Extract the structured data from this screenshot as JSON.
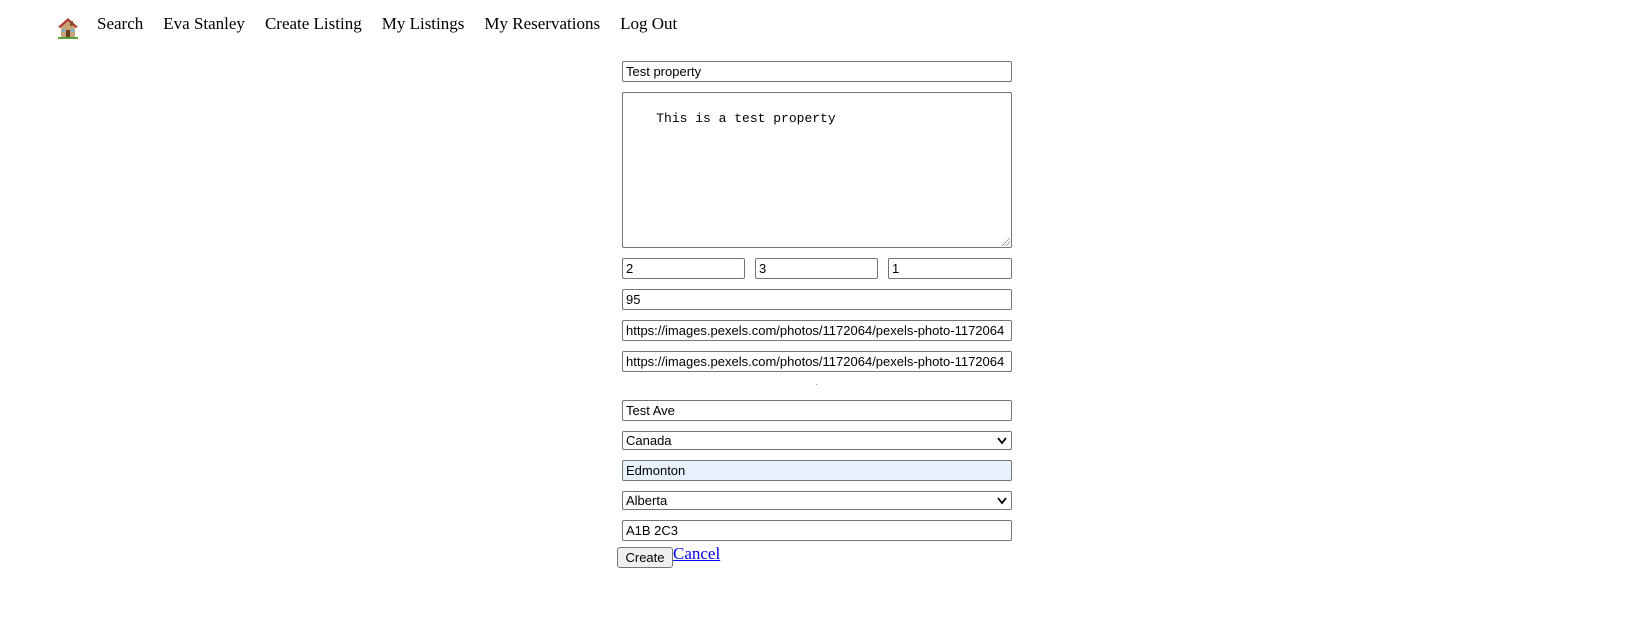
{
  "nav": {
    "home_icon": "house-icon",
    "items": [
      "Search",
      "Eva Stanley",
      "Create Listing",
      "My Listings",
      "My Reservations",
      "Log Out"
    ]
  },
  "form": {
    "title": "Test property",
    "description": "This is a test property",
    "bedrooms": "2",
    "beds": "3",
    "bathrooms": "1",
    "price": "95",
    "image_url_1": "https://images.pexels.com/photos/1172064/pexels-photo-1172064",
    "image_url_2": "https://images.pexels.com/photos/1172064/pexels-photo-1172064",
    "street": "Test Ave",
    "country": "Canada",
    "city": "Edmonton",
    "province": "Alberta",
    "postal_code": "A1B 2C3",
    "create_label": "Create",
    "cancel_label": "Cancel"
  }
}
